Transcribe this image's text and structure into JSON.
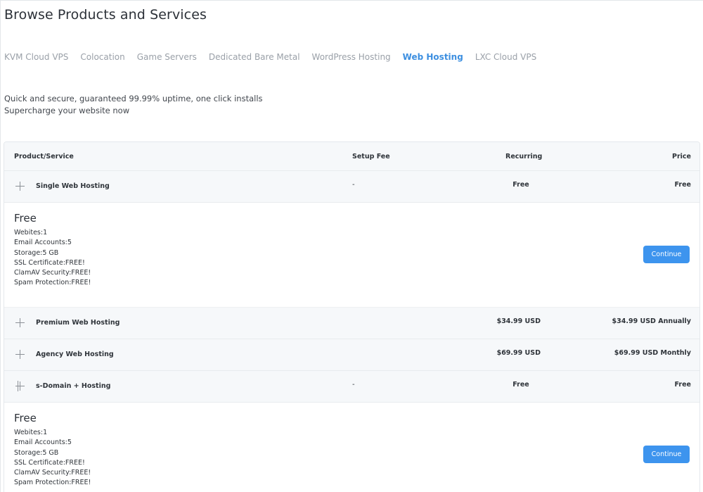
{
  "page": {
    "title": "Browse Products and Services"
  },
  "tabs": [
    {
      "label": "KVM Cloud VPS",
      "active": false
    },
    {
      "label": "Colocation",
      "active": false
    },
    {
      "label": "Game Servers",
      "active": false
    },
    {
      "label": "Dedicated Bare Metal",
      "active": false
    },
    {
      "label": "WordPress Hosting",
      "active": false
    },
    {
      "label": "Web Hosting",
      "active": true
    },
    {
      "label": "LXC Cloud VPS",
      "active": false
    }
  ],
  "description": {
    "line1": "Quick and secure, guaranteed 99.99% uptime, one click installs",
    "line2": "Supercharge your website now"
  },
  "table": {
    "headers": {
      "product": "Product/Service",
      "setup": "Setup Fee",
      "recurring": "Recurring",
      "price": "Price"
    },
    "rows": [
      {
        "name": "Single Web Hosting",
        "setup": "-",
        "recurring": "Free",
        "price": "Free",
        "expanded": true,
        "details": {
          "price": "Free",
          "features": [
            "Webites:1",
            "Email Accounts:5",
            "Storage:5 GB",
            "SSL Certificate:FREE!",
            "ClamAV Security:FREE!",
            "Spam Protection:FREE!"
          ],
          "button": "Continue"
        }
      },
      {
        "name": "Premium Web Hosting",
        "setup": "",
        "recurring": "$34.99 USD",
        "price": "$34.99 USD Annually",
        "expanded": false
      },
      {
        "name": "Agency Web Hosting",
        "setup": "",
        "recurring": "$69.99 USD",
        "price": "$69.99 USD Monthly",
        "expanded": false
      },
      {
        "name": "s-Domain + Hosting",
        "setup": "-",
        "recurring": "Free",
        "price": "Free",
        "expanded": true,
        "details": {
          "price": "Free",
          "features": [
            "Webites:1",
            "Email Accounts:5",
            "Storage:5 GB",
            "SSL Certificate:FREE!",
            "ClamAV Security:FREE!",
            "Spam Protection:FREE!"
          ],
          "button": "Continue"
        }
      }
    ]
  },
  "colors": {
    "accent": "#3d8fe0",
    "button": "#3d94ee",
    "header_bg": "#f6f8fa",
    "muted_tab": "#9aa0a8"
  },
  "icons": {
    "expand": "plus-icon"
  }
}
